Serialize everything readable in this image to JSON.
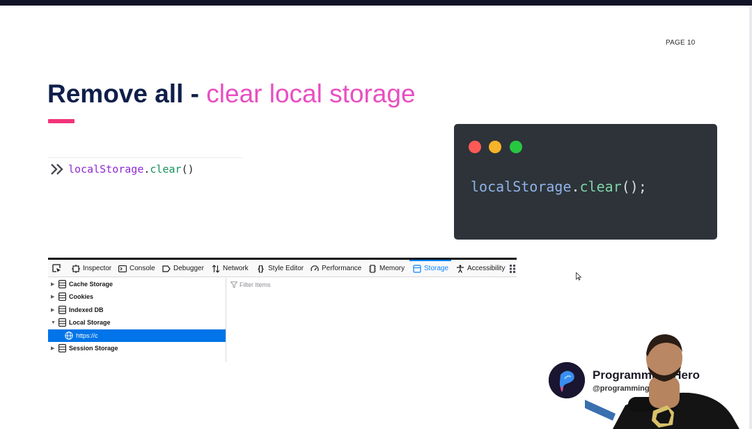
{
  "slide": {
    "page_label": "PAGE 10",
    "title_main": "Remove all",
    "title_separator": " - ",
    "title_accent": "clear local storage"
  },
  "console_snippet": {
    "object": "localStorage",
    "dot": ".",
    "method": "clear",
    "parens": "()"
  },
  "code_window": {
    "object": "localStorage",
    "dot": ".",
    "method": "clear",
    "parens": "();"
  },
  "devtools": {
    "tabs": [
      {
        "label": "Inspector",
        "icon": "inspector-icon"
      },
      {
        "label": "Console",
        "icon": "console-icon"
      },
      {
        "label": "Debugger",
        "icon": "debugger-icon"
      },
      {
        "label": "Network",
        "icon": "network-icon"
      },
      {
        "label": "Style Editor",
        "icon": "style-editor-icon"
      },
      {
        "label": "Performance",
        "icon": "performance-icon"
      },
      {
        "label": "Memory",
        "icon": "memory-icon"
      },
      {
        "label": "Storage",
        "icon": "storage-icon",
        "active": true
      },
      {
        "label": "Accessibility",
        "icon": "accessibility-icon"
      }
    ],
    "tree": [
      {
        "label": "Cache Storage",
        "expanded": false
      },
      {
        "label": "Cookies",
        "expanded": false
      },
      {
        "label": "Indexed DB",
        "expanded": false
      },
      {
        "label": "Local Storage",
        "expanded": true
      },
      {
        "label": "https://c",
        "selected": true
      },
      {
        "label": "Session Storage",
        "expanded": false
      }
    ],
    "filter_placeholder": "Filter Items"
  },
  "brand": {
    "name": "Programming Hero",
    "handle": "@programminghero"
  },
  "colors": {
    "title_navy": "#0f1f4a",
    "title_accent": "#e94ec1",
    "underline": "#f2347a",
    "code_bg": "#2d3339",
    "devtools_active": "#0a84ff",
    "tree_selected": "#0074e8"
  }
}
